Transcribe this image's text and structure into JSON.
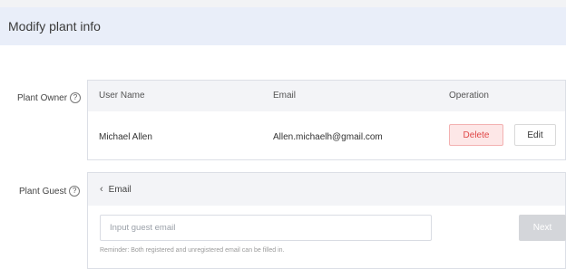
{
  "header": {
    "title": "Modify plant info"
  },
  "owner": {
    "label": "Plant Owner",
    "help_icon": "question-circle-icon",
    "columns": {
      "user": "User Name",
      "email": "Email",
      "operation": "Operation"
    },
    "row": {
      "user_name": "Michael Allen",
      "email": "Allen.michaelh@gmail.com"
    },
    "delete_label": "Delete",
    "edit_label": "Edit"
  },
  "guest": {
    "label": "Plant Guest",
    "help_icon": "question-circle-icon",
    "back_icon": "chevron-left-icon",
    "section_title": "Email",
    "input_placeholder": "Input guest email",
    "input_value": "",
    "next_label": "Next",
    "reminder": "Reminder: Both registered and unregistered email can be filled in."
  },
  "colors": {
    "header_bg": "#e9eef9",
    "danger": "#e04848",
    "disabled": "#d4d6da"
  }
}
